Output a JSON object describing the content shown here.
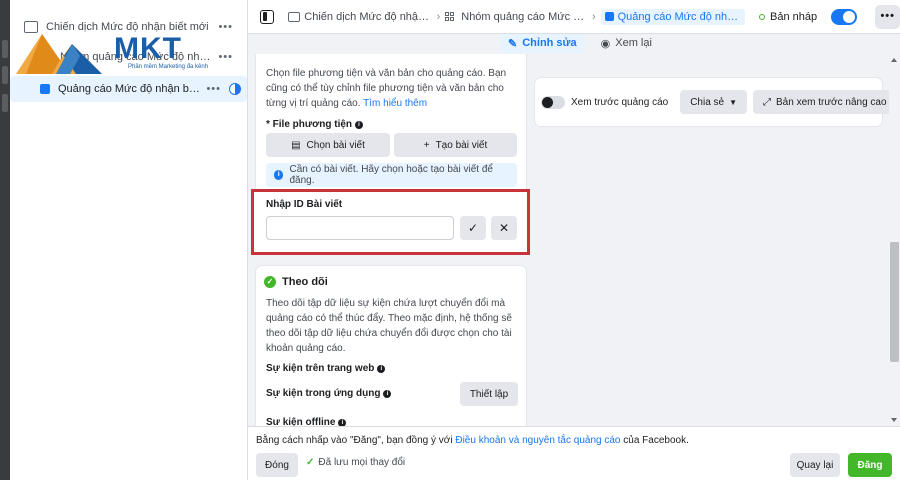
{
  "tree": {
    "items": [
      {
        "label": "Chiến dịch Mức độ nhận biết mới",
        "icon": "folder-icon"
      },
      {
        "label": "Nhóm quảng cáo Mức độ nhận biết mới",
        "icon": "grid-icon"
      },
      {
        "label": "Quảng cáo Mức độ nhận biết ...",
        "icon": "ad-icon"
      }
    ],
    "more": "•••"
  },
  "logo": {
    "text": "MKT",
    "tagline": "Phần mềm Marketing đa kênh"
  },
  "topbar": {
    "breadcrumbs": [
      {
        "label": "Chiến dịch Mức độ nhận biết r",
        "icon": "folder-icon"
      },
      {
        "label": "Nhóm quảng cáo Mức độ nhậ",
        "icon": "grid-icon"
      },
      {
        "label": "Quảng cáo Mức độ nhận biết",
        "icon": "ad-icon"
      }
    ],
    "status": "Bản nháp",
    "more": "•••"
  },
  "modes": {
    "edit": "Chỉnh sửa",
    "review": "Xem lại"
  },
  "media": {
    "intro": "Chọn file phương tiện và văn bản cho quảng cáo. Bạn cũng có thể tùy chỉnh file phương tiện và văn bản cho từng vị trí quảng cáo.",
    "learn_more": "Tìm hiểu thêm",
    "field_label": "* File phương tiện",
    "choose_post": "Chọn bài viết",
    "create_post": "Tạo bài viết",
    "notice": "Cần có bài viết. Hãy chọn hoặc tạo bài viết để đăng.",
    "post_id_label": "Nhập ID Bài viết",
    "post_id_value": ""
  },
  "tracking": {
    "title": "Theo dõi",
    "description": "Theo dõi tập dữ liệu sự kiện chứa lượt chuyển đổi mà quảng cáo có thể thúc đẩy. Theo mặc định, hệ thống sẽ theo dõi tập dữ liệu chứa chuyển đổi được chọn cho tài khoản quảng cáo.",
    "web_events": "Sự kiện trên trang web",
    "app_events": "Sự kiện trong ứng dụng",
    "setup": "Thiết lập",
    "offline_events": "Sự kiện offline"
  },
  "preview": {
    "toggle_label": "Xem trước quảng cáo",
    "share": "Chia sẻ",
    "advanced": "Bản xem trước nâng cao"
  },
  "footer": {
    "terms_prefix": "Bằng cách nhấp vào \"Đăng\", bạn đồng ý với ",
    "terms_link": "Điều khoản và nguyên tắc quảng cáo",
    "terms_suffix": " của Facebook.",
    "close": "Đóng",
    "saved": "Đã lưu mọi thay đổi",
    "back": "Quay lại",
    "publish": "Đăng"
  },
  "colors": {
    "accent": "#1877f2",
    "success": "#42b72a",
    "highlight": "#c8333a"
  }
}
